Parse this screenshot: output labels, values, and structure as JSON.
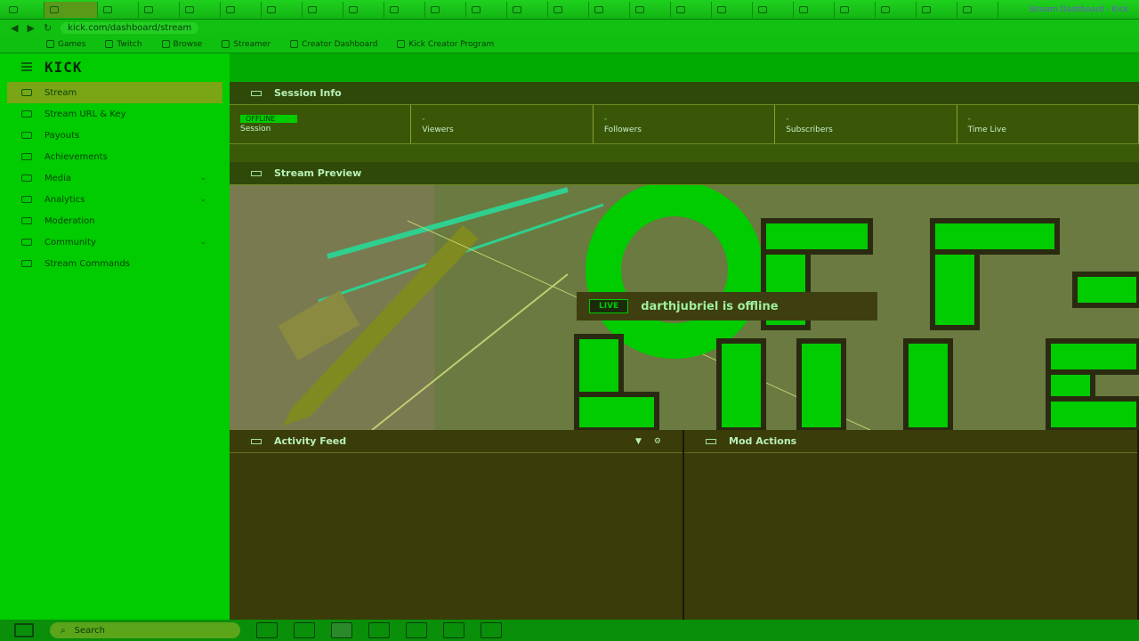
{
  "browser": {
    "tabs": [
      {
        "label": ""
      },
      {
        "label": ""
      },
      {
        "label": ""
      },
      {
        "label": ""
      },
      {
        "label": ""
      },
      {
        "label": ""
      },
      {
        "label": ""
      },
      {
        "label": ""
      },
      {
        "label": ""
      },
      {
        "label": ""
      },
      {
        "label": ""
      },
      {
        "label": ""
      },
      {
        "label": ""
      },
      {
        "label": ""
      },
      {
        "label": ""
      },
      {
        "label": ""
      },
      {
        "label": ""
      },
      {
        "label": ""
      },
      {
        "label": ""
      },
      {
        "label": ""
      },
      {
        "label": ""
      },
      {
        "label": ""
      },
      {
        "label": ""
      },
      {
        "label": ""
      }
    ],
    "window_title": "Stream Dashboard - Kick",
    "url": "kick.com/dashboard/stream",
    "bookmarks": [
      "Games",
      "Twitch",
      "Browse",
      "Streamer",
      "Creator Dashboard",
      "Kick Creator Program"
    ]
  },
  "sidebar": {
    "logo": "KICK",
    "items": [
      {
        "label": "Stream",
        "active": true
      },
      {
        "label": "Stream URL & Key",
        "chevron": false
      },
      {
        "label": "Payouts",
        "chevron": false
      },
      {
        "label": "Achievements",
        "chevron": false
      },
      {
        "label": "Media",
        "chevron": true
      },
      {
        "label": "Analytics",
        "chevron": true
      },
      {
        "label": "Moderation",
        "chevron": false
      },
      {
        "label": "Community",
        "chevron": true
      },
      {
        "label": "Stream Commands",
        "chevron": false
      }
    ]
  },
  "session": {
    "title": "Session Info",
    "cells": [
      {
        "value": "OFFLINE",
        "label": "Session"
      },
      {
        "value": "-",
        "label": "Viewers"
      },
      {
        "value": "-",
        "label": "Followers"
      },
      {
        "value": "-",
        "label": "Subscribers"
      },
      {
        "value": "-",
        "label": "Time Live"
      }
    ]
  },
  "preview": {
    "title": "Stream Preview",
    "live_badge": "LIVE",
    "offline_text": "darthjubriel is offline"
  },
  "activity": {
    "title": "Activity Feed"
  },
  "mod_actions": {
    "title": "Mod Actions"
  },
  "taskbar": {
    "search_placeholder": "Search"
  }
}
